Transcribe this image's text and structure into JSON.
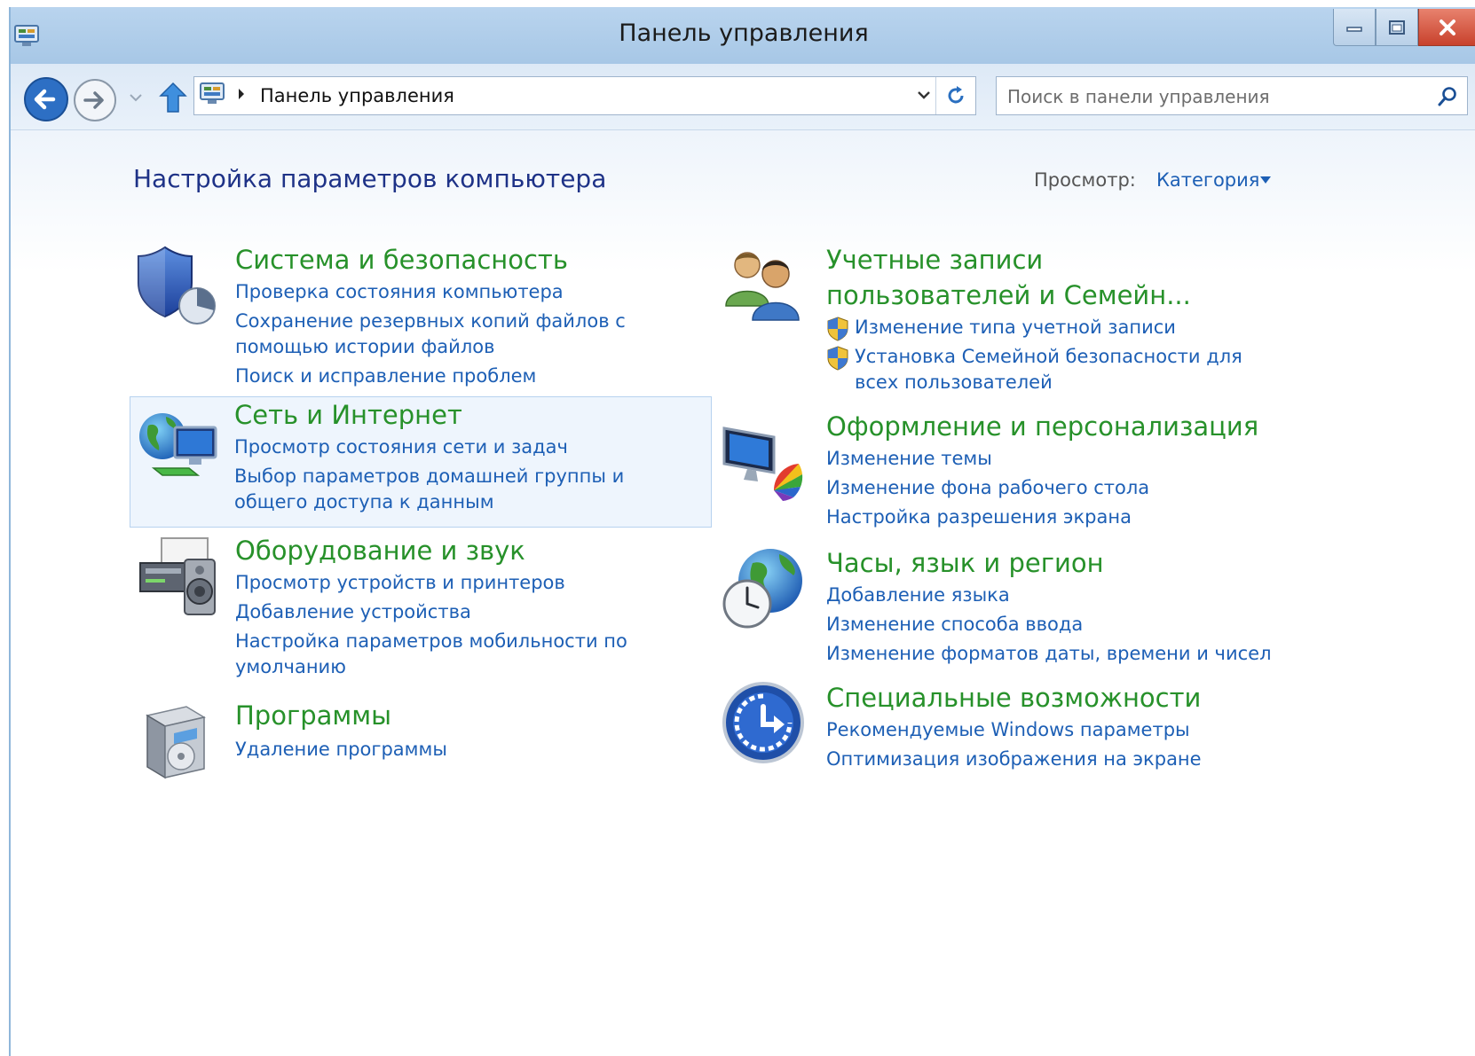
{
  "window": {
    "title": "Панель управления"
  },
  "nav": {
    "breadcrumb": "Панель управления",
    "search_placeholder": "Поиск в панели управления"
  },
  "content": {
    "heading": "Настройка параметров компьютера",
    "view_by_label": "Просмотр:",
    "view_by_value": "Категория"
  },
  "categories": [
    {
      "title": "Система и безопасность",
      "icon": "security-shield-icon",
      "links": [
        "Проверка состояния компьютера",
        "Сохранение резервных копий файлов с помощью истории файлов",
        "Поиск и исправление проблем"
      ]
    },
    {
      "title": "Сеть и Интернет",
      "icon": "network-globe-icon",
      "links": [
        "Просмотр состояния сети и задач",
        "Выбор параметров домашней группы и общего доступа к данным"
      ]
    },
    {
      "title": "Оборудование и звук",
      "icon": "printer-speaker-icon",
      "links": [
        "Просмотр устройств и принтеров",
        "Добавление устройства",
        "Настройка параметров мобильности по умолчанию"
      ]
    },
    {
      "title": "Программы",
      "icon": "programs-box-icon",
      "links": [
        "Удаление программы"
      ]
    },
    {
      "title": "Учетные записи пользователей и Семейн...",
      "icon": "users-icon",
      "links": [
        "Изменение типа учетной записи",
        "Установка Семейной безопасности для всех пользователей"
      ]
    },
    {
      "title": "Оформление и персонализация",
      "icon": "monitor-palette-icon",
      "links": [
        "Изменение темы",
        "Изменение фона рабочего стола",
        "Настройка разрешения экрана"
      ]
    },
    {
      "title": "Часы, язык и регион",
      "icon": "clock-globe-icon",
      "links": [
        "Добавление языка",
        "Изменение способа ввода",
        "Изменение форматов даты, времени и чисел"
      ]
    },
    {
      "title": "Специальные возможности",
      "icon": "accessibility-icon",
      "links": [
        "Рекомендуемые Windows параметры",
        "Оптимизация изображения на экране"
      ]
    }
  ],
  "colors": {
    "category_title": "#27912a",
    "link": "#1d5fb5",
    "heading": "#1e3287",
    "title_bar": "#b9d4ee",
    "close_button": "#c8412c"
  }
}
